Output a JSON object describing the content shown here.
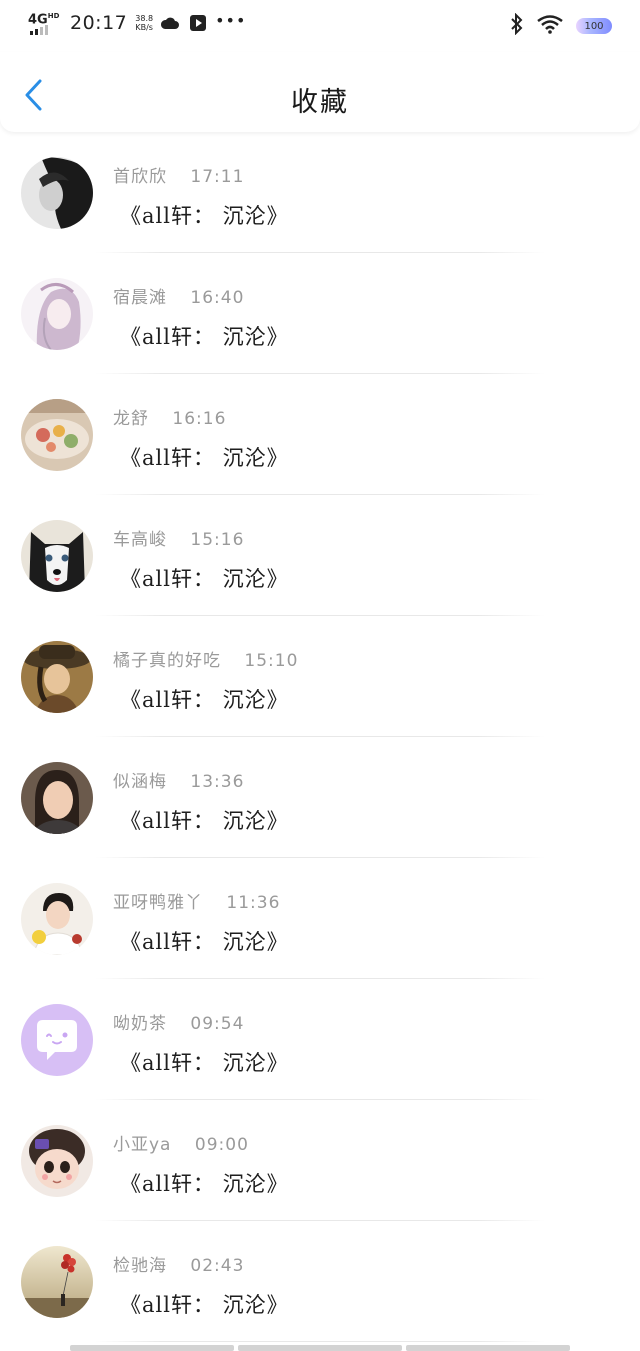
{
  "status_bar": {
    "network": "4G",
    "network_sup": "HD",
    "time": "20:17",
    "speed_value": "38.8",
    "speed_unit": "KB/s",
    "icons": [
      "cloud-icon",
      "play-box-icon",
      "more-dots-icon",
      "bluetooth-icon",
      "wifi-icon"
    ],
    "more": "•••",
    "battery": "100",
    "battery_color": "#8f9bff"
  },
  "header": {
    "back_icon": "chevron-left-icon",
    "back_color": "#2a8ee6",
    "title": "收藏"
  },
  "items": [
    {
      "name": "首欣欣",
      "time": "17:11",
      "content": "《all轩： 沉沦》",
      "avatar": "avatar-bw-portrait"
    },
    {
      "name": "宿晨滩",
      "time": "16:40",
      "content": "《all轩： 沉沦》",
      "avatar": "avatar-anime-sketch"
    },
    {
      "name": "龙舒",
      "time": "16:16",
      "content": "《all轩： 沉沦》",
      "avatar": "avatar-food"
    },
    {
      "name": "车高峻",
      "time": "15:16",
      "content": "《all轩： 沉沦》",
      "avatar": "avatar-husky"
    },
    {
      "name": "橘子真的好吃",
      "time": "15:10",
      "content": "《all轩： 沉沦》",
      "avatar": "avatar-hat-portrait"
    },
    {
      "name": "似涵梅",
      "time": "13:36",
      "content": "《all轩： 沉沦》",
      "avatar": "avatar-selfie"
    },
    {
      "name": "亚呀鸭雅丫",
      "time": "11:36",
      "content": "《all轩： 沉沦》",
      "avatar": "avatar-boy-flowers"
    },
    {
      "name": "呦奶茶",
      "time": "09:54",
      "content": "《all轩： 沉沦》",
      "avatar": "avatar-chat-bubble"
    },
    {
      "name": "小亚ya",
      "time": "09:00",
      "content": "《all轩： 沉沦》",
      "avatar": "avatar-cartoon-boy"
    },
    {
      "name": "检驰海",
      "time": "02:43",
      "content": "《all轩： 沉沦》",
      "avatar": "avatar-balloons"
    }
  ]
}
